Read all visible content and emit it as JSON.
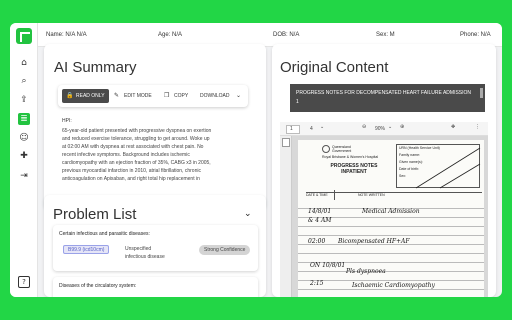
{
  "patient": {
    "name": "Name: N/A N/A",
    "age": "Age: N/A",
    "dob": "DOB: N/A",
    "sex": "Sex: M",
    "phone": "Phone: N/A"
  },
  "summary": {
    "title": "AI Summary",
    "read_only": "READ ONLY",
    "edit_mode": "EDIT MODE",
    "copy": "COPY",
    "download": "DOWNLOAD",
    "hpi_label": "HPI:",
    "hpi_lines": [
      "65-year-old patient presented with progressive dyspnea on exertion",
      "and reduced exercise tolerance, struggling to get around. Woke up",
      "at 02:00 AM with dyspnea at rest associated with chest pain. No",
      "recent infective symptoms. Background includes ischemic",
      "cardiomyopathy with an ejection fraction of 35%, CABG x3 in 2005,",
      "previous myocardial infarction in 2010, atrial fibrillation, chronic",
      "anticoagulation on Apixaban, and right total hip replacement in"
    ]
  },
  "problems": {
    "title": "Problem List",
    "group1_title": "Certain infectious and parasitic diseases:",
    "code": "B99.9 (icd10cm)",
    "desc_line1": "Unspecified",
    "desc_line2": "infectious disease",
    "confidence": "Strong Confidence",
    "group2_title": "Diseases of the circulatory system:"
  },
  "original": {
    "title": "Original Content",
    "doc_title": "PROGRESS NOTES FOR DECOMPENSATED HEART FAILURE ADMISSION",
    "doc_index": "1",
    "page_num": "1",
    "page_total": "4",
    "zoom": "90%",
    "form_title_line1": "PROGRESS NOTES",
    "form_title_line2": "INPATIENT",
    "form_org_line1": "Queensland",
    "form_org_line2": "Government",
    "form_hospital": "Royal Brisbane & Women's Hospital",
    "form_urn": "URN (Health Service Unit)",
    "form_family": "Family name:",
    "form_given": "Given name(s):",
    "form_dob": "Date of birth:",
    "form_sex": "Sex:",
    "col_date": "DATE & TIME",
    "col_note": "NOTE WRITTEN",
    "hand_lines": [
      "Medical Admission",
      "Bicompensated HF+AF",
      "Pls dyspnoea",
      "Ischaemic Cardiomyopathy"
    ],
    "hand_dates": [
      "14/8/01",
      "& 4 AM",
      "02:00",
      "ON 10/8/01",
      "2:15"
    ]
  }
}
